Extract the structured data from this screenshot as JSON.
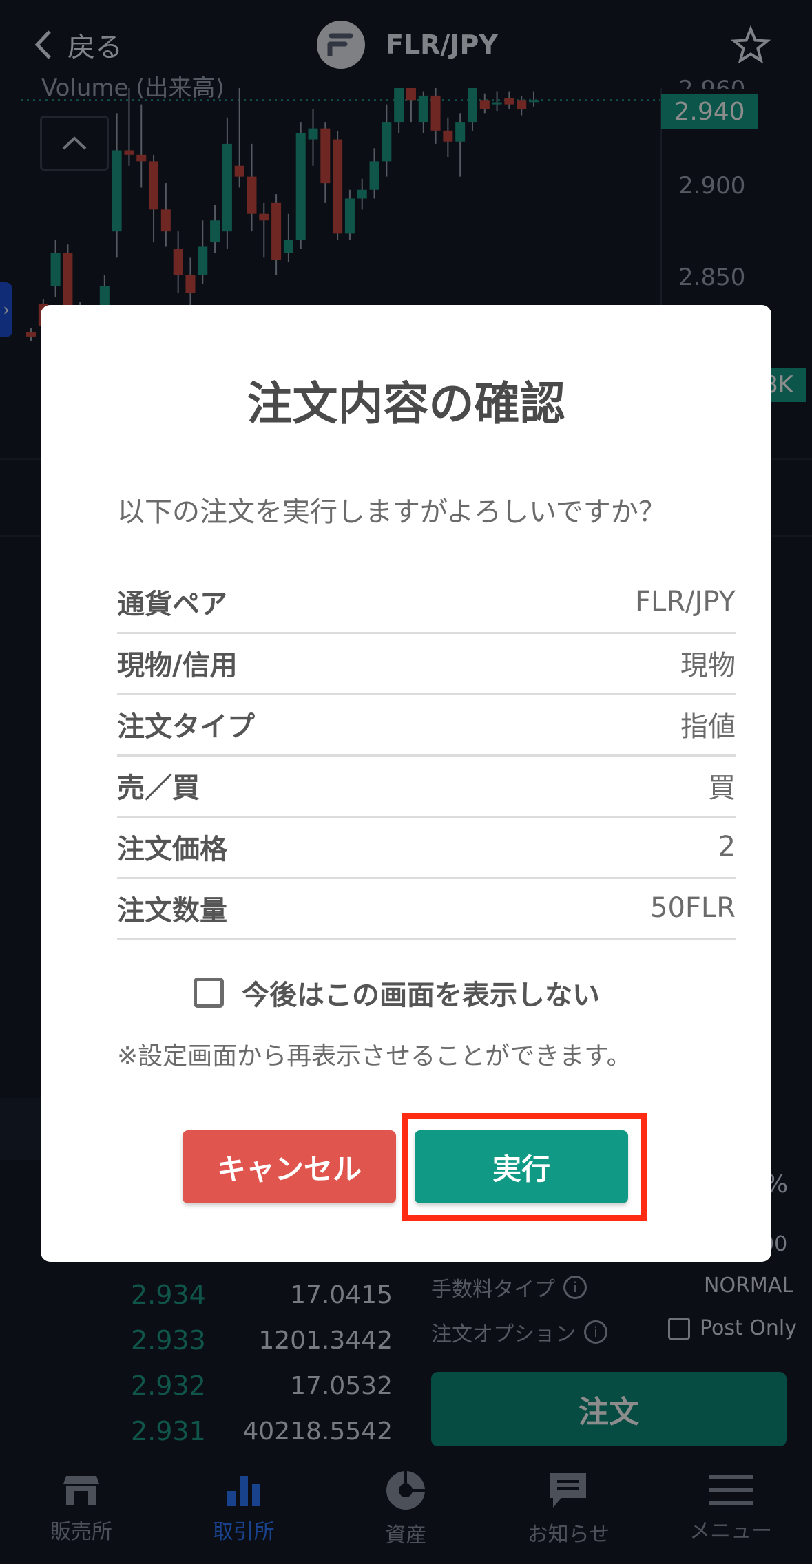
{
  "header": {
    "back_label": "戻る",
    "pair": "FLR/JPY"
  },
  "chart": {
    "volume_label": "Volume (出来高)",
    "current_price": "2.940",
    "y_ticks": [
      "2.960",
      "2.900",
      "2.850"
    ],
    "volume_tag": "8K",
    "candles": [
      {
        "o": 2.834,
        "c": 2.832,
        "h": 2.836,
        "l": 2.83
      },
      {
        "o": 2.847,
        "c": 2.837,
        "h": 2.849,
        "l": 2.835
      },
      {
        "o": 2.855,
        "c": 2.87,
        "h": 2.876,
        "l": 2.85
      },
      {
        "o": 2.87,
        "c": 2.845,
        "h": 2.874,
        "l": 2.842
      },
      {
        "o": 2.845,
        "c": 2.842,
        "h": 2.848,
        "l": 2.84
      },
      {
        "o": 2.842,
        "c": 2.838,
        "h": 2.845,
        "l": 2.836
      },
      {
        "o": 2.836,
        "c": 2.855,
        "h": 2.86,
        "l": 2.833
      },
      {
        "o": 2.88,
        "c": 2.917,
        "h": 2.934,
        "l": 2.868
      },
      {
        "o": 2.917,
        "c": 2.915,
        "h": 2.948,
        "l": 2.91
      },
      {
        "o": 2.915,
        "c": 2.912,
        "h": 2.938,
        "l": 2.9
      },
      {
        "o": 2.912,
        "c": 2.89,
        "h": 2.915,
        "l": 2.875
      },
      {
        "o": 2.89,
        "c": 2.88,
        "h": 2.902,
        "l": 2.873
      },
      {
        "o": 2.872,
        "c": 2.86,
        "h": 2.88,
        "l": 2.852
      },
      {
        "o": 2.86,
        "c": 2.852,
        "h": 2.868,
        "l": 2.84
      },
      {
        "o": 2.86,
        "c": 2.873,
        "h": 2.885,
        "l": 2.856
      },
      {
        "o": 2.875,
        "c": 2.885,
        "h": 2.892,
        "l": 2.87
      },
      {
        "o": 2.88,
        "c": 2.92,
        "h": 2.932,
        "l": 2.872
      },
      {
        "o": 2.91,
        "c": 2.905,
        "h": 2.946,
        "l": 2.9
      },
      {
        "o": 2.905,
        "c": 2.888,
        "h": 2.92,
        "l": 2.88
      },
      {
        "o": 2.888,
        "c": 2.885,
        "h": 2.893,
        "l": 2.868
      },
      {
        "o": 2.893,
        "c": 2.867,
        "h": 2.897,
        "l": 2.86
      },
      {
        "o": 2.87,
        "c": 2.876,
        "h": 2.888,
        "l": 2.866
      },
      {
        "o": 2.876,
        "c": 2.925,
        "h": 2.93,
        "l": 2.872
      },
      {
        "o": 2.922,
        "c": 2.927,
        "h": 2.936,
        "l": 2.91
      },
      {
        "o": 2.927,
        "c": 2.902,
        "h": 2.93,
        "l": 2.893
      },
      {
        "o": 2.922,
        "c": 2.879,
        "h": 2.926,
        "l": 2.876
      },
      {
        "o": 2.879,
        "c": 2.895,
        "h": 2.899,
        "l": 2.876
      },
      {
        "o": 2.895,
        "c": 2.899,
        "h": 2.904,
        "l": 2.89
      },
      {
        "o": 2.899,
        "c": 2.912,
        "h": 2.918,
        "l": 2.895
      },
      {
        "o": 2.912,
        "c": 2.93,
        "h": 2.938,
        "l": 2.905
      },
      {
        "o": 2.93,
        "c": 2.955,
        "h": 2.958,
        "l": 2.925
      },
      {
        "o": 2.953,
        "c": 2.94,
        "h": 2.956,
        "l": 2.93
      },
      {
        "o": 2.93,
        "c": 2.942,
        "h": 2.944,
        "l": 2.925
      },
      {
        "o": 2.942,
        "c": 2.926,
        "h": 2.946,
        "l": 2.92
      },
      {
        "o": 2.926,
        "c": 2.921,
        "h": 2.932,
        "l": 2.914
      },
      {
        "o": 2.921,
        "c": 2.93,
        "h": 2.934,
        "l": 2.905
      },
      {
        "o": 2.93,
        "c": 2.948,
        "h": 2.952,
        "l": 2.926
      },
      {
        "o": 2.94,
        "c": 2.936,
        "h": 2.943,
        "l": 2.934
      },
      {
        "o": 2.938,
        "c": 2.939,
        "h": 2.944,
        "l": 2.935
      },
      {
        "o": 2.941,
        "c": 2.938,
        "h": 2.944,
        "l": 2.936
      },
      {
        "o": 2.94,
        "c": 2.936,
        "h": 2.942,
        "l": 2.933
      },
      {
        "o": 2.94,
        "c": 2.94,
        "h": 2.944,
        "l": 2.937
      }
    ],
    "colors": {
      "up": "#1e9c85",
      "down": "#c8473f"
    }
  },
  "modal": {
    "title": "注文内容の確認",
    "message": "以下の注文を実行しますがよろしいですか？",
    "rows": [
      {
        "label": "通貨ペア",
        "value": "FLR/JPY"
      },
      {
        "label": "現物/信用",
        "value": "現物"
      },
      {
        "label": "注文タイプ",
        "value": "指値"
      },
      {
        "label": "売／買",
        "value": "買"
      },
      {
        "label": "注文価格",
        "value": "2"
      },
      {
        "label": "注文数量",
        "value": "50FLR"
      }
    ],
    "checkbox_label": "今後はこの画面を表示しない",
    "note": "※設定画面から再表示させることができます。",
    "cancel_label": "キャンセル",
    "execute_label": "実行"
  },
  "orderbook": [
    {
      "price": "2.934",
      "qty": "17.0415"
    },
    {
      "price": "2.933",
      "qty": "1201.3442"
    },
    {
      "price": "2.932",
      "qty": "17.0532"
    },
    {
      "price": "2.931",
      "qty": "40218.5542"
    }
  ],
  "order_panel": {
    "fee_type_label": "手数料タイプ",
    "fee_type_value": "NORMAL",
    "option_label": "注文オプション",
    "post_only_label": "Post Only",
    "order_button": "注文",
    "partial_percent": "%",
    "partial_zero": "00"
  },
  "nav": [
    {
      "label": "販売所",
      "icon": "shop-icon"
    },
    {
      "label": "取引所",
      "icon": "bar-chart-icon"
    },
    {
      "label": "資産",
      "icon": "pie-chart-icon"
    },
    {
      "label": "お知らせ",
      "icon": "message-icon"
    },
    {
      "label": "メニュー",
      "icon": "hamburger-menu-icon"
    }
  ],
  "colors": {
    "accent": "#109a86",
    "danger": "#e0564f",
    "highlight": "#ff2b12",
    "nav_active": "#2f78ff"
  }
}
